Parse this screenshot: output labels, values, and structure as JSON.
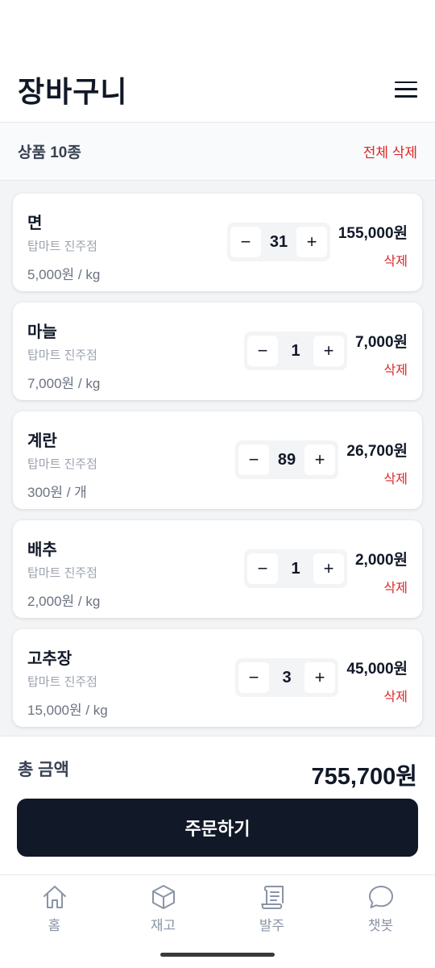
{
  "header": {
    "title": "장바구니"
  },
  "summary": {
    "count_label": "상품 10종",
    "delete_all_label": "전체 삭제"
  },
  "items": [
    {
      "name": "면",
      "store": "탑마트 진주점",
      "unit_price": "5,000원 / kg",
      "qty": "31",
      "total": "155,000원",
      "delete_label": "삭제"
    },
    {
      "name": "마늘",
      "store": "탑마트 진주점",
      "unit_price": "7,000원 / kg",
      "qty": "1",
      "total": "7,000원",
      "delete_label": "삭제"
    },
    {
      "name": "계란",
      "store": "탑마트 진주점",
      "unit_price": "300원 / 개",
      "qty": "89",
      "total": "26,700원",
      "delete_label": "삭제"
    },
    {
      "name": "배추",
      "store": "탑마트 진주점",
      "unit_price": "2,000원 / kg",
      "qty": "1",
      "total": "2,000원",
      "delete_label": "삭제"
    },
    {
      "name": "고추장",
      "store": "탑마트 진주점",
      "unit_price": "15,000원 / kg",
      "qty": "3",
      "total": "45,000원",
      "delete_label": "삭제"
    }
  ],
  "stepper": {
    "minus": "−",
    "plus": "+"
  },
  "footer": {
    "total_label": "총 금액",
    "total_value": "755,700원",
    "order_button": "주문하기"
  },
  "nav": [
    {
      "label": "홈",
      "icon": "home-icon"
    },
    {
      "label": "재고",
      "icon": "box-icon"
    },
    {
      "label": "발주",
      "icon": "scroll-icon"
    },
    {
      "label": "챗봇",
      "icon": "chat-bubble-icon"
    }
  ],
  "colors": {
    "accent_dark": "#111827",
    "danger": "#dc2626",
    "muted": "#9ca3af"
  }
}
